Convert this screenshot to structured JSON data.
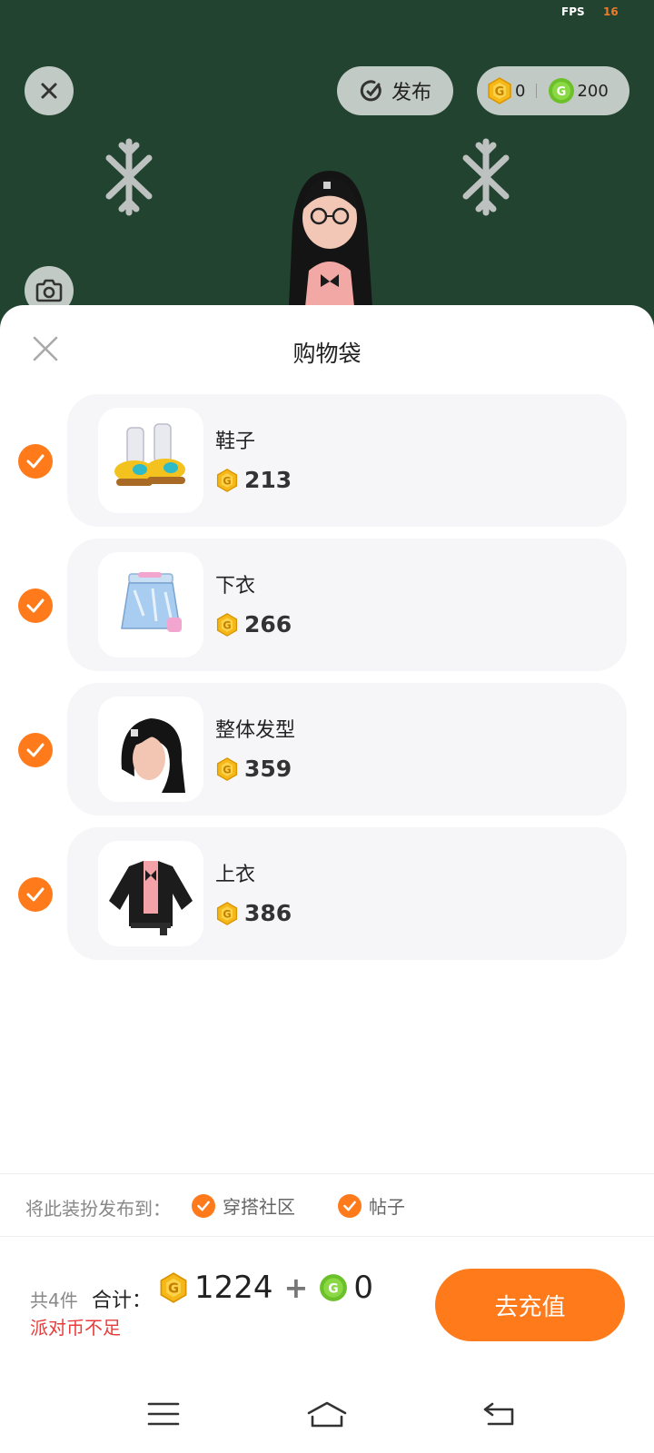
{
  "status": {
    "fps_label": "FPS",
    "fps_value": "16"
  },
  "scene": {
    "publish_label": "发布",
    "party_coins": "0",
    "green_coins": "200"
  },
  "sheet": {
    "title": "购物袋",
    "items": [
      {
        "name": "鞋子",
        "price": "213",
        "checked": true,
        "icon": "shoes-icon"
      },
      {
        "name": "下衣",
        "price": "266",
        "checked": true,
        "icon": "skirt-icon"
      },
      {
        "name": "整体发型",
        "price": "359",
        "checked": true,
        "icon": "hairstyle-icon"
      },
      {
        "name": "上衣",
        "price": "386",
        "checked": true,
        "icon": "jacket-icon"
      }
    ],
    "publish_to": {
      "label": "将此装扮发布到：",
      "options": [
        {
          "label": "穿搭社区",
          "checked": true
        },
        {
          "label": "帖子",
          "checked": true
        }
      ]
    },
    "footer": {
      "count_text": "共4件",
      "total_label": "合计：",
      "gold_total": "1224",
      "plus": "+",
      "green_total": "0",
      "warning": "派对币不足",
      "recharge_label": "去充值"
    }
  },
  "colors": {
    "accent": "#ff7a1a",
    "scene_bg": "#234331",
    "warning": "#e83c3c",
    "gold_coin": "#f5b818",
    "green_coin": "#6cc12a"
  }
}
